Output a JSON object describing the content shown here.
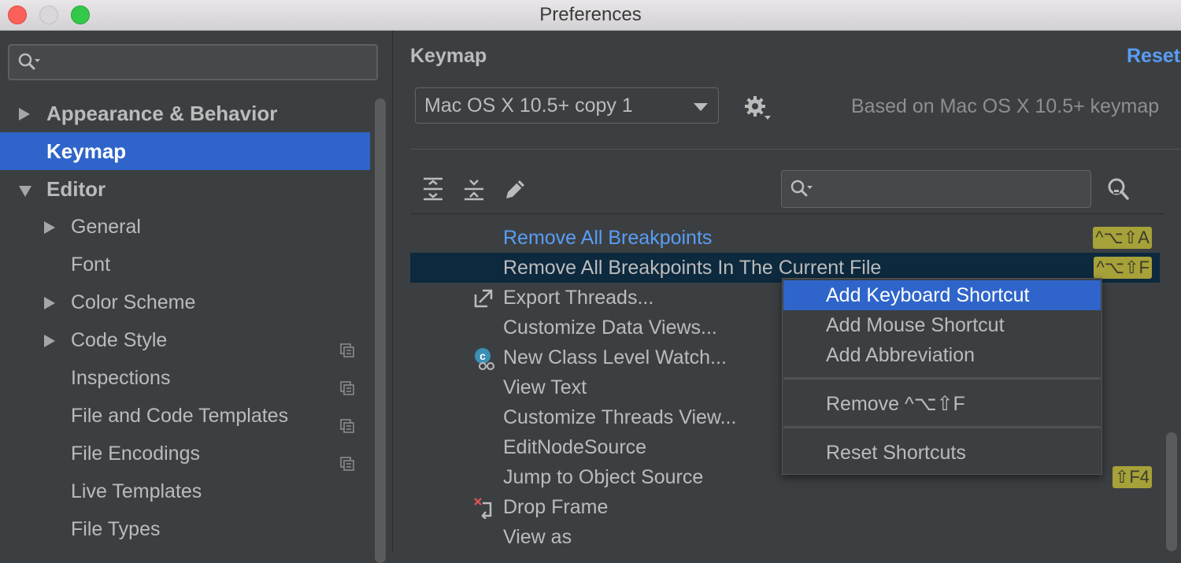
{
  "window": {
    "title": "Preferences"
  },
  "sidebar": {
    "items": [
      {
        "label": "Appearance & Behavior",
        "arrow": "right",
        "bold": true,
        "selected": false,
        "copy": false
      },
      {
        "label": "Keymap",
        "arrow": "none",
        "bold": true,
        "selected": true,
        "copy": false
      },
      {
        "label": "Editor",
        "arrow": "down",
        "bold": true,
        "selected": false,
        "copy": false
      },
      {
        "label": "General",
        "arrow": "right",
        "bold": false,
        "selected": false,
        "copy": false
      },
      {
        "label": "Font",
        "arrow": "none",
        "bold": false,
        "selected": false,
        "copy": false
      },
      {
        "label": "Color Scheme",
        "arrow": "right",
        "bold": false,
        "selected": false,
        "copy": false
      },
      {
        "label": "Code Style",
        "arrow": "right",
        "bold": false,
        "selected": false,
        "copy": true
      },
      {
        "label": "Inspections",
        "arrow": "none",
        "bold": false,
        "selected": false,
        "copy": true
      },
      {
        "label": "File and Code Templates",
        "arrow": "none",
        "bold": false,
        "selected": false,
        "copy": true
      },
      {
        "label": "File Encodings",
        "arrow": "none",
        "bold": false,
        "selected": false,
        "copy": true
      },
      {
        "label": "Live Templates",
        "arrow": "none",
        "bold": false,
        "selected": false,
        "copy": false
      },
      {
        "label": "File Types",
        "arrow": "none",
        "bold": false,
        "selected": false,
        "copy": false
      }
    ]
  },
  "main": {
    "title": "Keymap",
    "reset_label": "Reset",
    "keymap_select": {
      "value": "Mac OS X 10.5+ copy 1"
    },
    "based_on": "Based on Mac OS X 10.5+ keymap",
    "toolbar": {
      "expand_all_icon": "expand-all-icon",
      "collapse_all_icon": "collapse-all-icon",
      "edit_icon": "pencil-icon",
      "find_shortcut_icon": "find-by-shortcut-icon"
    },
    "actions": [
      {
        "label": "Remove All Breakpoints",
        "shortcut": "^⌥⇧A",
        "modified": true,
        "selected": false,
        "icon": ""
      },
      {
        "label": "Remove All Breakpoints In The Current File",
        "shortcut": "^⌥⇧F",
        "modified": false,
        "selected": true,
        "icon": ""
      },
      {
        "label": "Export Threads...",
        "shortcut": "",
        "modified": false,
        "selected": false,
        "icon": "export-icon"
      },
      {
        "label": "Customize Data Views...",
        "shortcut": "",
        "modified": false,
        "selected": false,
        "icon": ""
      },
      {
        "label": "New Class Level Watch...",
        "shortcut": "",
        "modified": false,
        "selected": false,
        "icon": "class-watch-icon"
      },
      {
        "label": "View Text",
        "shortcut": "",
        "modified": false,
        "selected": false,
        "icon": ""
      },
      {
        "label": "Customize Threads View...",
        "shortcut": "",
        "modified": false,
        "selected": false,
        "icon": ""
      },
      {
        "label": "EditNodeSource",
        "shortcut": "",
        "modified": false,
        "selected": false,
        "icon": ""
      },
      {
        "label": "Jump to Object Source",
        "shortcut": "⇧F4",
        "modified": false,
        "selected": false,
        "icon": ""
      },
      {
        "label": "Drop Frame",
        "shortcut": "",
        "modified": false,
        "selected": false,
        "icon": "drop-frame-icon"
      },
      {
        "label": "View as",
        "shortcut": "",
        "modified": false,
        "selected": false,
        "icon": ""
      }
    ]
  },
  "context_menu": {
    "items": [
      {
        "label": "Add Keyboard Shortcut",
        "highlight": true
      },
      {
        "label": "Add Mouse Shortcut",
        "highlight": false
      },
      {
        "label": "Add Abbreviation",
        "highlight": false
      },
      {
        "separator": true
      },
      {
        "label": "Remove ^⌥⇧F",
        "highlight": false
      },
      {
        "separator": true
      },
      {
        "label": "Reset Shortcuts",
        "highlight": false
      }
    ]
  },
  "colors": {
    "selection": "#2f65ca",
    "row_selection": "#0d293e",
    "link": "#589df6",
    "shortcut_badge": "#a6a139"
  }
}
